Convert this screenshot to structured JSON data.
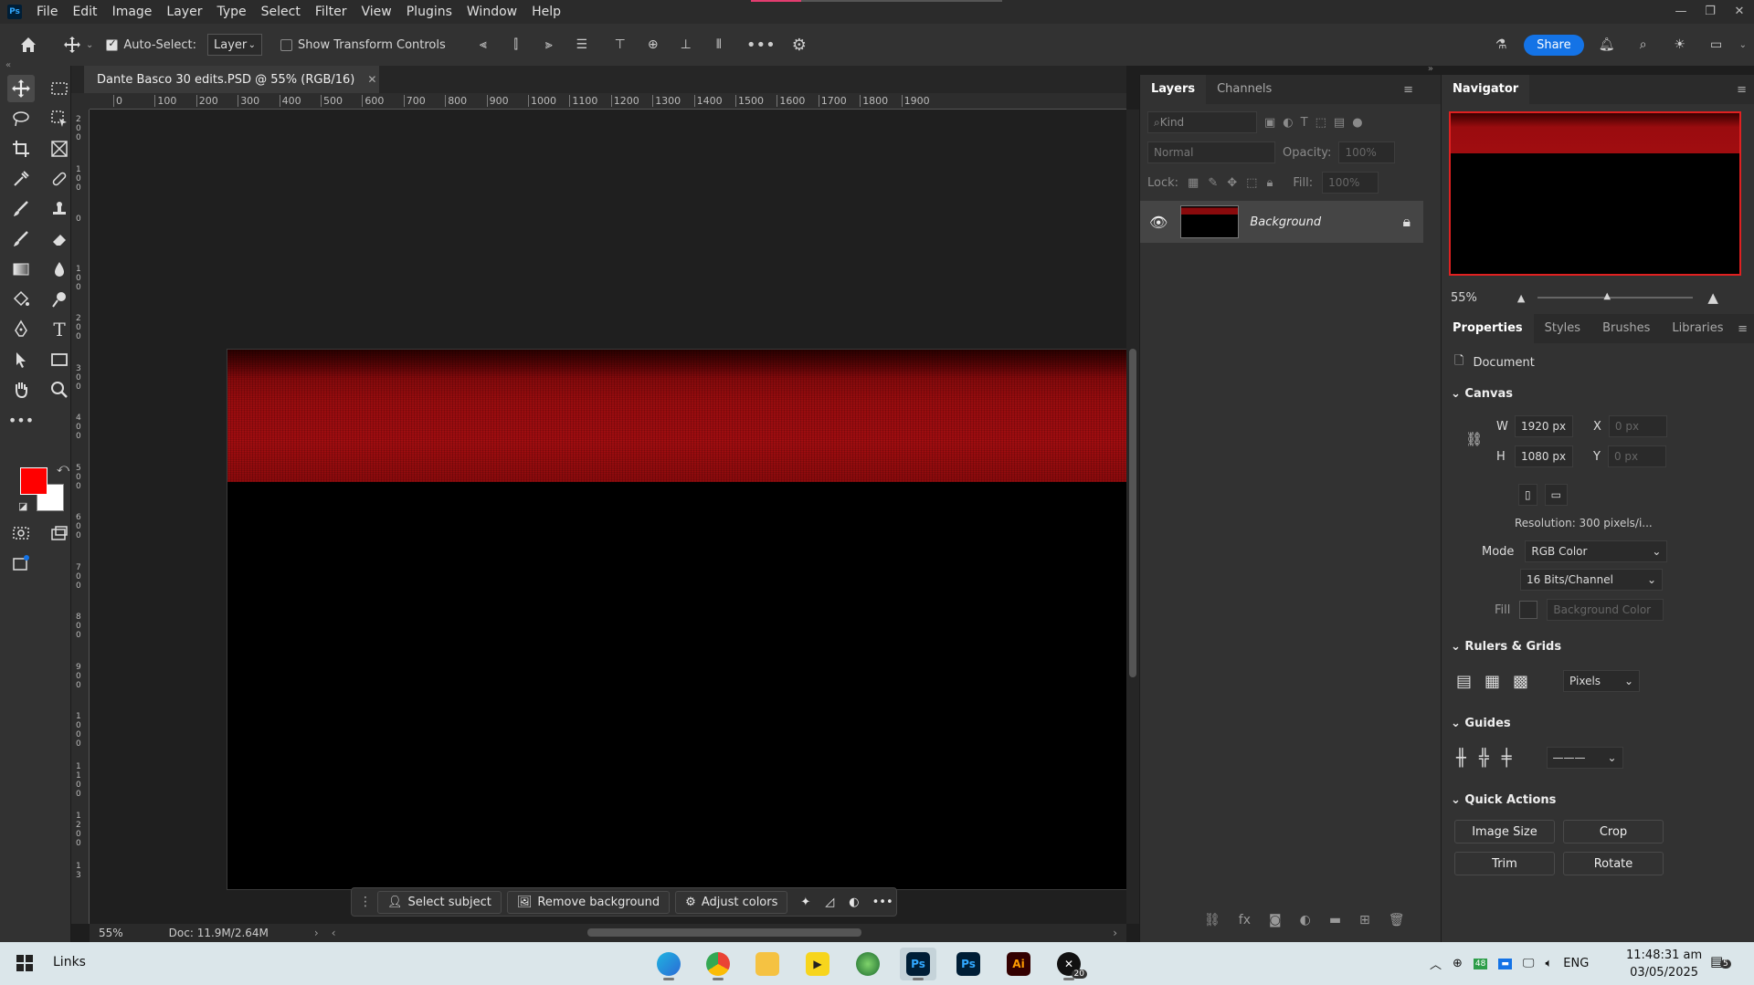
{
  "menubar": {
    "logo": "Ps",
    "items": [
      "File",
      "Edit",
      "Image",
      "Layer",
      "Type",
      "Select",
      "Filter",
      "View",
      "Plugins",
      "Window",
      "Help"
    ]
  },
  "options": {
    "auto_select_label": "Auto-Select:",
    "auto_select_target": "Layer",
    "show_transform_label": "Show Transform Controls",
    "share_label": "Share"
  },
  "document": {
    "tab_title": "Dante Basco 30 edits.PSD @ 55% (RGB/16)",
    "ruler_h_ticks": [
      "0",
      "100",
      "200",
      "300",
      "400",
      "500",
      "600",
      "700",
      "800",
      "900",
      "1000",
      "1100",
      "1200",
      "1300",
      "1400",
      "1500",
      "1600",
      "1700",
      "1800",
      "1900"
    ],
    "ruler_v_ticks": [
      "2\n0\n0",
      "1\n0\n0",
      "0",
      "1\n0\n0",
      "2\n0\n0",
      "3\n0\n0",
      "4\n0\n0",
      "5\n0\n0",
      "6\n0\n0",
      "7\n0\n0",
      "8\n0\n0",
      "9\n0\n0",
      "1\n0\n0\n0",
      "1\n1\n0\n0",
      "1\n2\n0\n0",
      "1\n3"
    ]
  },
  "context_bar": {
    "select_subject": "Select subject",
    "remove_background": "Remove background",
    "adjust_colors": "Adjust colors"
  },
  "status": {
    "zoom": "55%",
    "doc_size": "Doc: 11.9M/2.64M"
  },
  "layers": {
    "tabs": [
      "Layers",
      "Channels"
    ],
    "kind_placeholder": "Kind",
    "blend_mode": "Normal",
    "opacity_label": "Opacity:",
    "opacity_value": "100%",
    "lock_label": "Lock:",
    "fill_label": "Fill:",
    "fill_value": "100%",
    "items": [
      {
        "name": "Background"
      }
    ]
  },
  "navigator": {
    "title": "Navigator",
    "zoom": "55%"
  },
  "properties": {
    "tabs": [
      "Properties",
      "Styles",
      "Brushes",
      "Libraries"
    ],
    "doc_label": "Document",
    "canvas_title": "Canvas",
    "w_label": "W",
    "w_value": "1920 px",
    "h_label": "H",
    "h_value": "1080 px",
    "x_label": "X",
    "x_value": "0 px",
    "y_label": "Y",
    "y_value": "0 px",
    "resolution": "Resolution: 300 pixels/i...",
    "mode_label": "Mode",
    "mode_value": "RGB Color",
    "bits_value": "16 Bits/Channel",
    "fill_label": "Fill",
    "fill_value": "Background Color",
    "rulers_title": "Rulers & Grids",
    "units_value": "Pixels",
    "guides_title": "Guides",
    "quick_actions_title": "Quick Actions",
    "qa": [
      "Image Size",
      "Crop",
      "Trim",
      "Rotate"
    ]
  },
  "taskbar": {
    "links_label": "Links",
    "lang": "ENG",
    "time": "11:48:31 am",
    "date": "03/05/2025",
    "notif_count": "5",
    "app_badge": "20",
    "apps": [
      "edge",
      "chrome",
      "file-explorer",
      "media-player",
      "network-app",
      "Ps",
      "Ps",
      "Ai",
      "x-app"
    ]
  },
  "colors": {
    "foreground": "#ff0000",
    "background": "#ffffff",
    "accent": "#1473e6"
  }
}
